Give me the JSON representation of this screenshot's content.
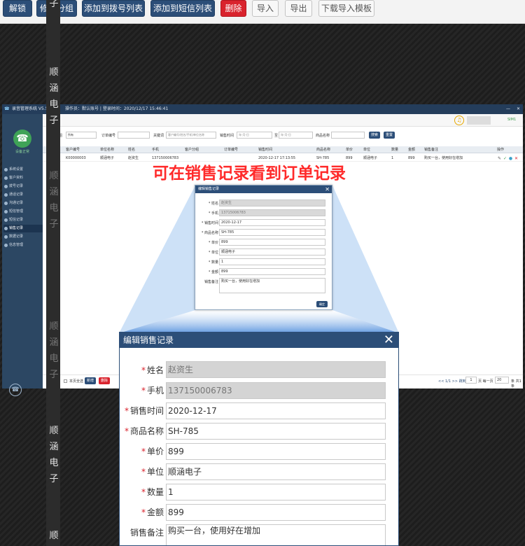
{
  "toolbar": {
    "buttons": [
      "解锁",
      "修改分组",
      "添加到拨号列表",
      "添加到短信列表",
      "删除",
      "导入",
      "导出",
      "下载导入模板"
    ],
    "colors": {
      "primary": "#2c4e78",
      "danger": "#d9232d",
      "neutral": "#f8f8f8"
    }
  },
  "watermark": {
    "partial": "子",
    "text": "顺涵电子",
    "bottom": "顺"
  },
  "app": {
    "title": "录音管理系统 V5.5",
    "login_info": "操作员：默认账号 | 登录时间：2020/12/17 15:46:41",
    "sim_label": "SIM1",
    "status": "设备正常",
    "nav": [
      "系统设置",
      "客户资料",
      "拨号记录",
      "通话记录",
      "沟通记录",
      "短信管理",
      "短信记录",
      "销售记录",
      "数据记录",
      "信息管理"
    ],
    "active_nav_index": 7,
    "filters": {
      "group_label": "客户分组",
      "group_value": "所有",
      "order_label": "订单编号",
      "keyword_label": "关键词",
      "keyword_placeholder": "客户编号/姓名/手机/单位名称",
      "time_label": "销售时间",
      "date_placeholder": "年-月-日",
      "to_label": "至",
      "product_label": "商品名称",
      "search_button": "搜索",
      "reset_button": "重置"
    },
    "grid": {
      "headers": [
        "客户编号",
        "单位名称",
        "姓名",
        "手机",
        "客户分组",
        "订单编号",
        "销售时间",
        "商品名称",
        "单价",
        "单位",
        "数量",
        "金额",
        "销售备注",
        "操作"
      ],
      "row": {
        "index": "1",
        "cells": [
          "K00000003",
          "顺涵电子",
          "赵资生",
          "137150006783",
          "",
          "",
          "2020-12-17 17:13:55",
          "SH-785",
          "899",
          "顺涵电子",
          "1",
          "899",
          "购买一台，使用好在增加"
        ]
      }
    },
    "footer": {
      "select_all": "全选",
      "select_page": "本页全选",
      "add_button": "新增",
      "delete_button": "删除",
      "pager": "<< 1/1 >> 跳到",
      "page_input": "1",
      "per_page_label": "页 每一页",
      "per_page_value": "20",
      "total": "条 共1条"
    }
  },
  "banner": "可在销售记录看到订单记录",
  "dialog_small": {
    "title": "编辑销售记录",
    "fields": [
      {
        "label": "* 姓名",
        "value": "赵资生"
      },
      {
        "label": "* 手机",
        "value": "13715006783"
      },
      {
        "label": "* 销售时间",
        "value": "2020-12-17"
      },
      {
        "label": "* 商品名称",
        "value": "SH-785"
      },
      {
        "label": "* 单价",
        "value": "899"
      },
      {
        "label": "* 单位",
        "value": "顺涵电子"
      },
      {
        "label": "* 数量",
        "value": "1"
      },
      {
        "label": "* 金额",
        "value": "899"
      },
      {
        "label": "销售备注",
        "value": "购买一台，使用好在增加"
      }
    ],
    "ok_button": "确定"
  },
  "dialog_zoom": {
    "title": "编辑销售记录",
    "fields": [
      {
        "label": "姓名",
        "required": true,
        "value": "赵资生",
        "readonly": true
      },
      {
        "label": "手机",
        "required": true,
        "value": "137150006783",
        "readonly": true
      },
      {
        "label": "销售时间",
        "required": true,
        "value": "2020-12-17",
        "readonly": false
      },
      {
        "label": "商品名称",
        "required": true,
        "value": "SH-785",
        "readonly": false
      },
      {
        "label": "单价",
        "required": true,
        "value": "899",
        "readonly": false
      },
      {
        "label": "单位",
        "required": true,
        "value": "顺涵电子",
        "readonly": false
      },
      {
        "label": "数量",
        "required": true,
        "value": "1",
        "readonly": false
      },
      {
        "label": "金额",
        "required": true,
        "value": "899",
        "readonly": false
      },
      {
        "label": "销售备注",
        "required": false,
        "value": "购买一台，使用好在增加",
        "readonly": false
      }
    ],
    "required_mark": "*"
  }
}
